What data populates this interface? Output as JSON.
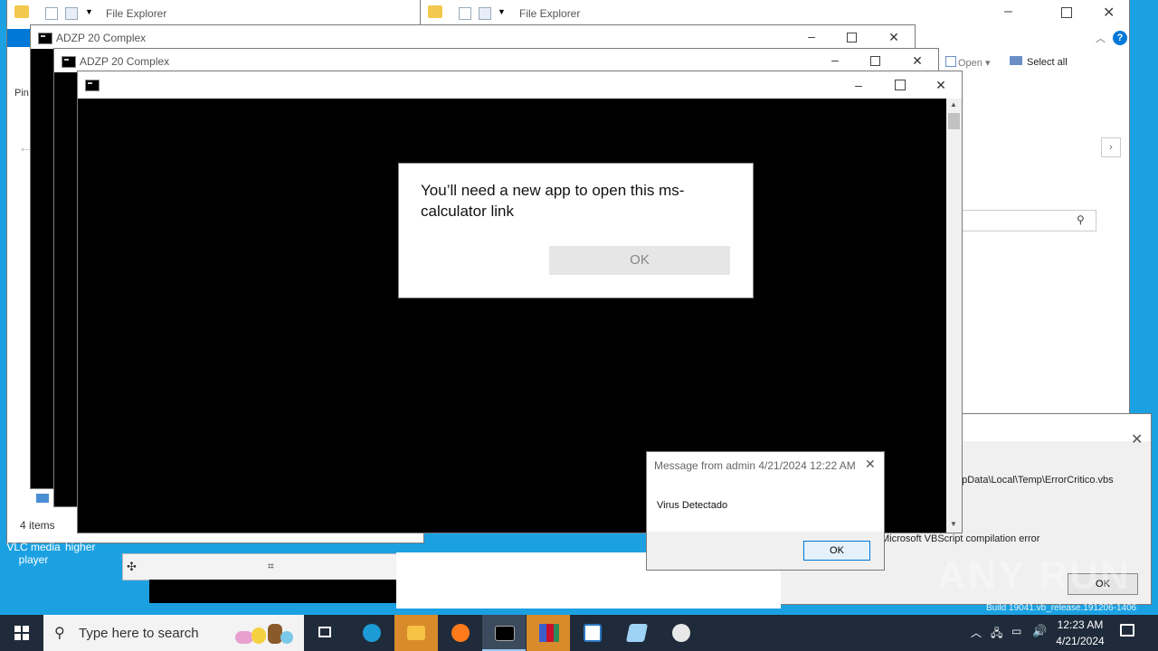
{
  "explorer_left": {
    "title": "File Explorer",
    "status_items": "4 items",
    "pin_label": "Pin"
  },
  "explorer_right": {
    "title": "File Explorer",
    "open_label": "Open ▾",
    "select_all_label": "Select all"
  },
  "cmd_window_1": {
    "title": "ADZP 20 Complex"
  },
  "cmd_window_2": {
    "title": "ADZP 20 Complex"
  },
  "cmd_window_3": {
    "title": ""
  },
  "app_dialog": {
    "message": "You’ll need a new app to open this ms-calculator link",
    "ok_label": "OK"
  },
  "msg_dialog": {
    "title": "Message from admin 4/21/2024 12:22 AM",
    "body": "Virus Detectado",
    "ok_label": "OK"
  },
  "vbs_error": {
    "path_text": "ppData\\Local\\Temp\\ErrorCritico.vbs",
    "error_text": "Microsoft VBScript compilation error",
    "ok_label": "OK"
  },
  "desktop": {
    "icons": [
      {
        "label": "VLC media player"
      },
      {
        "label": "higher"
      }
    ],
    "build_text": "Build 19041.vb_release.191206-1406"
  },
  "watermark": {
    "text": "ANY RUN"
  },
  "taskbar": {
    "search_placeholder": "Type here to search",
    "time": "12:23 AM",
    "date": "4/21/2024"
  },
  "colors": {
    "desktop": "#1ba1e2",
    "taskbar": "#1f2b3a",
    "accent": "#0078d7"
  }
}
